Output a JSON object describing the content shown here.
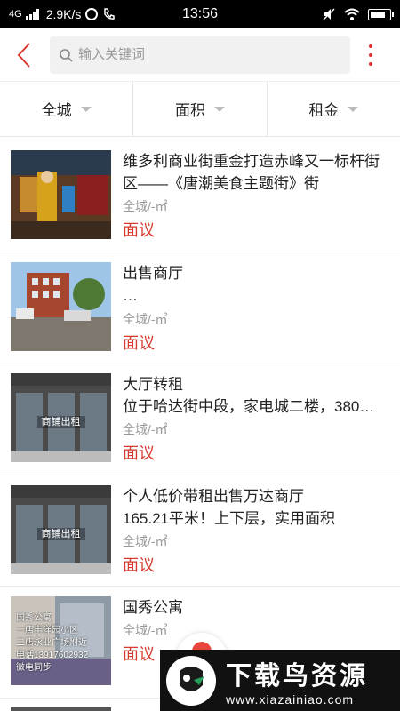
{
  "status_bar": {
    "network": "4G",
    "speed": "2.9K/s",
    "time": "13:56"
  },
  "header": {
    "search_placeholder": "输入关键词"
  },
  "filters": [
    {
      "label": "全城"
    },
    {
      "label": "面积"
    },
    {
      "label": "租金"
    }
  ],
  "listings": [
    {
      "title": "维多利商业街重金打造赤峰又一标杆街区——《唐潮美食主题街》街",
      "desc": "",
      "area": "全城/-㎡",
      "price": "面议"
    },
    {
      "title": "出售商厅",
      "desc": "…",
      "area": "全城/-㎡",
      "price": "面议"
    },
    {
      "title": "大厅转租",
      "desc": "位于哈达街中段，家电城二楼，380…",
      "area": "全城/-㎡",
      "price": "面议",
      "image_tag": "商铺出租"
    },
    {
      "title": "个人低价带租出售万达商厅",
      "desc": "165.21平米！上下层，实用面积",
      "area": "全城/-㎡",
      "price": "面议",
      "image_tag": "商铺出租"
    },
    {
      "title": "国秀公寓",
      "desc": "",
      "area": "全城/-㎡",
      "price": "面议",
      "image_text": "国秀公寓\n一店丰洋园小区\n二店永业广场附近\n电话13917602932\n微电同步"
    }
  ],
  "watermark": {
    "brand": "下载鸟资源",
    "url": "www.xiazainiao.com"
  },
  "colors": {
    "accent": "#d63a2f",
    "muted": "#999999",
    "divider": "#ececec"
  }
}
